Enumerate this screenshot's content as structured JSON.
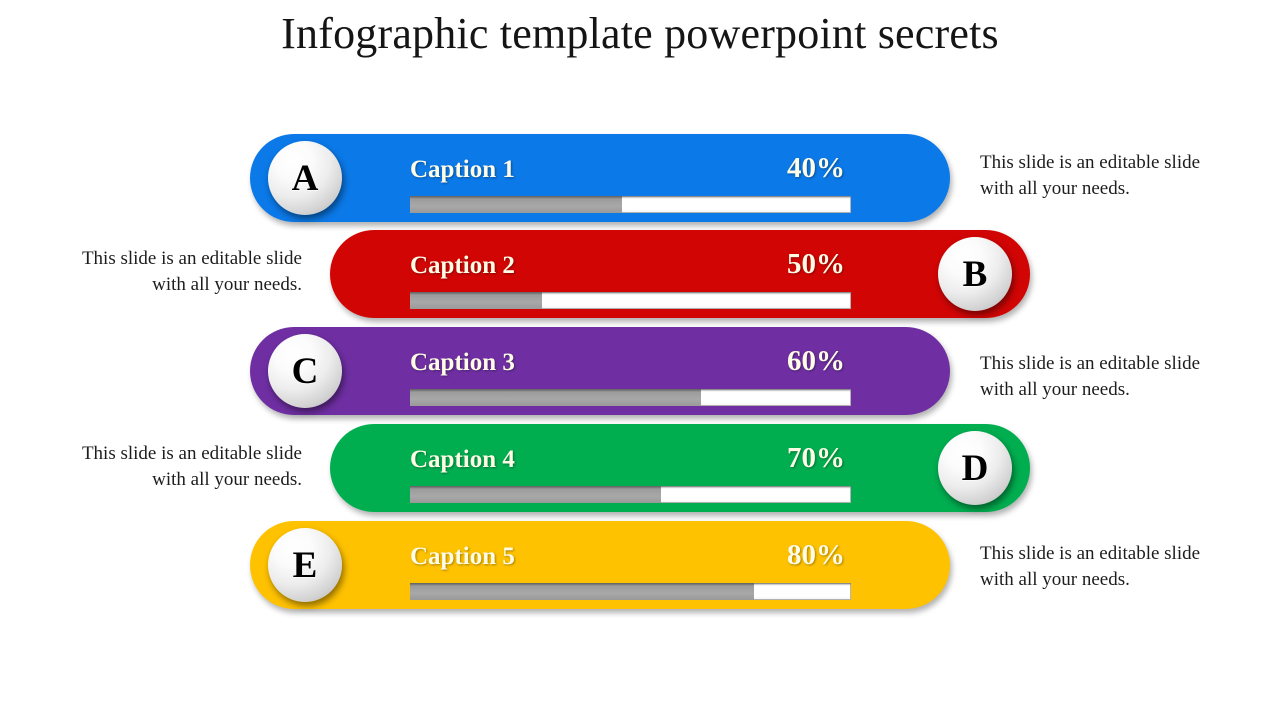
{
  "slide": {
    "title": "Infographic template powerpoint secrets",
    "background_color": "#ffffff"
  },
  "chart_data": {
    "type": "bar",
    "title": "Infographic template powerpoint secrets",
    "xlabel": "",
    "ylabel": "",
    "categories": [
      "Caption 1",
      "Caption 2",
      "Caption 3",
      "Caption 4",
      "Caption 5"
    ],
    "values": [
      40,
      50,
      60,
      70,
      80
    ],
    "value_labels": [
      "40%",
      "50%",
      "60%",
      "70%",
      "80%"
    ],
    "badge_labels": [
      "A",
      "B",
      "C",
      "D",
      "E"
    ],
    "series_colors": [
      "#0b79e8",
      "#d20505",
      "#6f2fa3",
      "#00ae50",
      "#ffc200"
    ],
    "bar_fill_ratios": [
      0.48,
      0.3,
      0.66,
      0.57,
      0.78
    ],
    "ylim": [
      0,
      100
    ],
    "grid": false,
    "legend": "none",
    "orientation": "horizontal"
  },
  "rows": [
    {
      "badge": "A",
      "caption": "Caption 1",
      "percent": "40%",
      "color": "#0b79e8",
      "badge_side": "left",
      "note_side": "right",
      "fill_ratio": 0.48,
      "note": "This slide is an editable slide with all your needs."
    },
    {
      "badge": "B",
      "caption": "Caption 2",
      "percent": "50%",
      "color": "#d20505",
      "badge_side": "right",
      "note_side": "left",
      "fill_ratio": 0.3,
      "note": "This slide is an editable slide with all your needs."
    },
    {
      "badge": "C",
      "caption": "Caption 3",
      "percent": "60%",
      "color": "#6f2fa3",
      "badge_side": "left",
      "note_side": "right",
      "fill_ratio": 0.66,
      "note": "This slide is an editable slide with all your needs."
    },
    {
      "badge": "D",
      "caption": "Caption 4",
      "percent": "70%",
      "color": "#00ae50",
      "badge_side": "right",
      "note_side": "left",
      "fill_ratio": 0.57,
      "note": "This slide is an editable slide with all your needs."
    },
    {
      "badge": "E",
      "caption": "Caption 5",
      "percent": "80%",
      "color": "#ffc200",
      "badge_side": "left",
      "note_side": "right",
      "fill_ratio": 0.78,
      "note": "This slide is an editable slide with all your needs."
    }
  ]
}
